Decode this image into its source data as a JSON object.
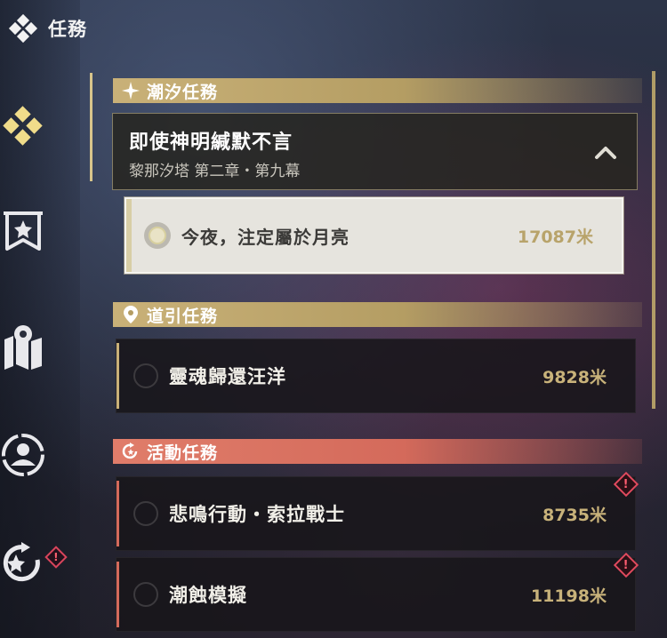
{
  "header": {
    "title": "任務",
    "icon": "four-diamond-icon"
  },
  "sidebar": {
    "items": [
      {
        "name": "nav-tide-quests",
        "icon": "four-diamond-icon",
        "active": true,
        "color": "#f0dc8a"
      },
      {
        "name": "nav-main-story",
        "icon": "banner-star-icon",
        "active": false
      },
      {
        "name": "nav-map-quests",
        "icon": "map-pin-icon",
        "active": false
      },
      {
        "name": "nav-companion-quests",
        "icon": "person-circle-icon",
        "active": false
      },
      {
        "name": "nav-event-quests",
        "icon": "star-refresh-icon",
        "active": false,
        "badge": "!"
      }
    ]
  },
  "sections": {
    "tide": {
      "label": "潮汐任務",
      "icon": "sparkle-icon",
      "group": {
        "title": "即使神明緘默不言",
        "subtitle": "黎那汐塔 第二章・第九幕",
        "expanded": true
      },
      "tasks": [
        {
          "label": "今夜，注定屬於月亮",
          "distance": "17087米",
          "selected": true
        }
      ]
    },
    "guide": {
      "label": "道引任務",
      "icon": "location-pin-icon",
      "tasks": [
        {
          "label": "靈魂歸還汪洋",
          "distance": "9828米"
        }
      ]
    },
    "event": {
      "label": "活動任務",
      "icon": "refresh-star-icon",
      "tasks": [
        {
          "label": "悲鳴行動・索拉戰士",
          "distance": "8735米",
          "badge": "!"
        },
        {
          "label": "潮蝕模擬",
          "distance": "11198米",
          "badge": "!"
        }
      ]
    }
  },
  "colors": {
    "gold": "#c9b178",
    "event_red": "#d46a5b",
    "active_yellow": "#f0dc8a",
    "alert": "#e04a5e"
  }
}
